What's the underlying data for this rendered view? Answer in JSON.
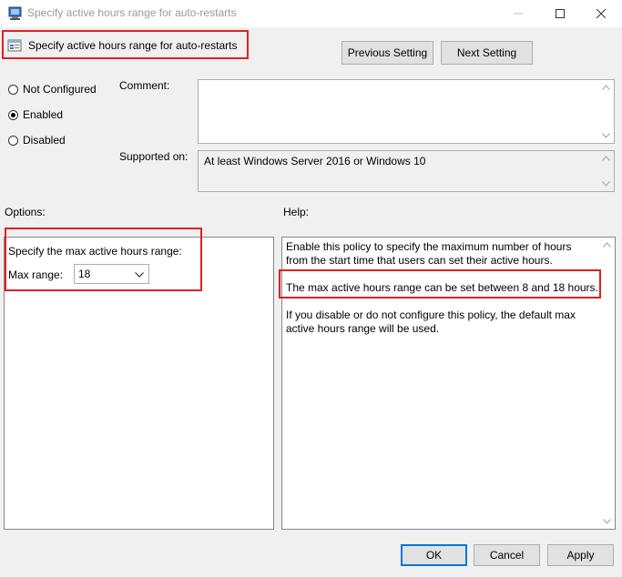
{
  "window": {
    "title": "Specify active hours range for auto-restarts"
  },
  "header": {
    "policy_title": "Specify active hours range for auto-restarts",
    "previous_label": "Previous Setting",
    "next_label": "Next Setting"
  },
  "state": {
    "options": [
      {
        "label": "Not Configured",
        "checked": false
      },
      {
        "label": "Enabled",
        "checked": true
      },
      {
        "label": "Disabled",
        "checked": false
      }
    ]
  },
  "comment": {
    "label": "Comment:",
    "value": ""
  },
  "supported": {
    "label": "Supported on:",
    "value": "At least Windows Server 2016 or Windows 10"
  },
  "options_panel": {
    "heading": "Options:",
    "description": "Specify the max active hours range:",
    "max_range_label": "Max range:",
    "max_range_value": "18"
  },
  "help_panel": {
    "heading": "Help:",
    "paragraph1": "Enable this policy to specify the maximum number of hours from the start time that users can set their active hours.",
    "paragraph2": "The max active hours range can be set between 8 and 18 hours.",
    "paragraph3": "If you disable or do not configure this policy, the default max active hours range will be used."
  },
  "footer": {
    "ok_label": "OK",
    "cancel_label": "Cancel",
    "apply_label": "Apply"
  },
  "colors": {
    "highlight_border": "#e02020",
    "default_button_border": "#0078d7",
    "dialog_background": "#f0f0f0"
  }
}
